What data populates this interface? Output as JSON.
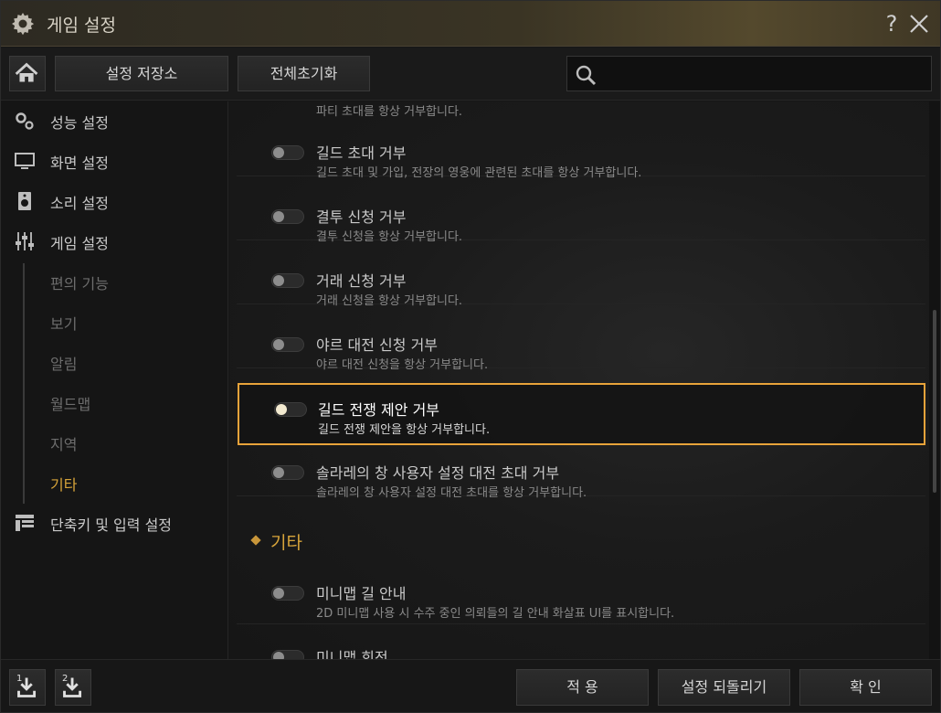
{
  "window": {
    "title": "게임 설정",
    "help_label": "?",
    "icons": {
      "title": "gear-icon",
      "close": "close-icon",
      "help": "question-icon"
    }
  },
  "toolbar": {
    "home_icon": "home-icon",
    "save_store_label": "설정 저장소",
    "reset_all_label": "전체초기화",
    "search": {
      "placeholder": "",
      "value": "",
      "icon": "search-icon"
    }
  },
  "sidebar": {
    "items": [
      {
        "label": "성능 설정",
        "icon": "gears-icon"
      },
      {
        "label": "화면 설정",
        "icon": "monitor-icon"
      },
      {
        "label": "소리 설정",
        "icon": "speaker-icon"
      },
      {
        "label": "게임 설정",
        "icon": "sliders-icon"
      },
      {
        "label": "단축키 및 입력 설정",
        "icon": "layout-icon"
      }
    ],
    "sub_items": [
      {
        "label": "편의 기능",
        "active": false
      },
      {
        "label": "보기",
        "active": false
      },
      {
        "label": "알림",
        "active": false
      },
      {
        "label": "월드맵",
        "active": false
      },
      {
        "label": "지역",
        "active": false
      },
      {
        "label": "기타",
        "active": true
      }
    ]
  },
  "content": {
    "top_desc": "파티 초대를 항상 거부합니다.",
    "rows": [
      {
        "title": "길드 초대 거부",
        "desc": "길드 초대 및 가입, 전장의 영웅에 관련된 초대를 항상 거부합니다.",
        "on": false
      },
      {
        "title": "결투 신청 거부",
        "desc": "결투 신청을 항상 거부합니다.",
        "on": false
      },
      {
        "title": "거래 신청 거부",
        "desc": "거래 신청을 항상 거부합니다.",
        "on": false
      },
      {
        "title": "야르 대전 신청 거부",
        "desc": "야르 대전 신청을 항상 거부합니다.",
        "on": false
      },
      {
        "title": "길드 전쟁 제안 거부",
        "desc": "길드 전쟁 제안을 항상 거부합니다.",
        "on": false,
        "highlighted": true
      },
      {
        "title": "솔라레의 창 사용자 설정 대전 초대 거부",
        "desc": "솔라레의 창 사용자 설정 대전 초대를 항상 거부합니다.",
        "on": false
      }
    ],
    "section": {
      "label": "기타"
    },
    "section_rows": [
      {
        "title": "미니맵 길 안내",
        "desc": "2D 미니맵 사용 시 수주 중인 의뢰들의 길 안내 화살표 UI를 표시합니다.",
        "on": false
      },
      {
        "title": "미니맵 회전",
        "desc": "",
        "on": false
      }
    ]
  },
  "footer": {
    "slot1_label": "1",
    "slot2_label": "2",
    "slot_icon": "download-icon",
    "apply_label": "적 용",
    "revert_label": "설정 되돌리기",
    "confirm_label": "확 인"
  },
  "colors": {
    "accent": "#d7a43a",
    "highlight_border": "#e8a33a",
    "title_bar": "#3a3424"
  }
}
